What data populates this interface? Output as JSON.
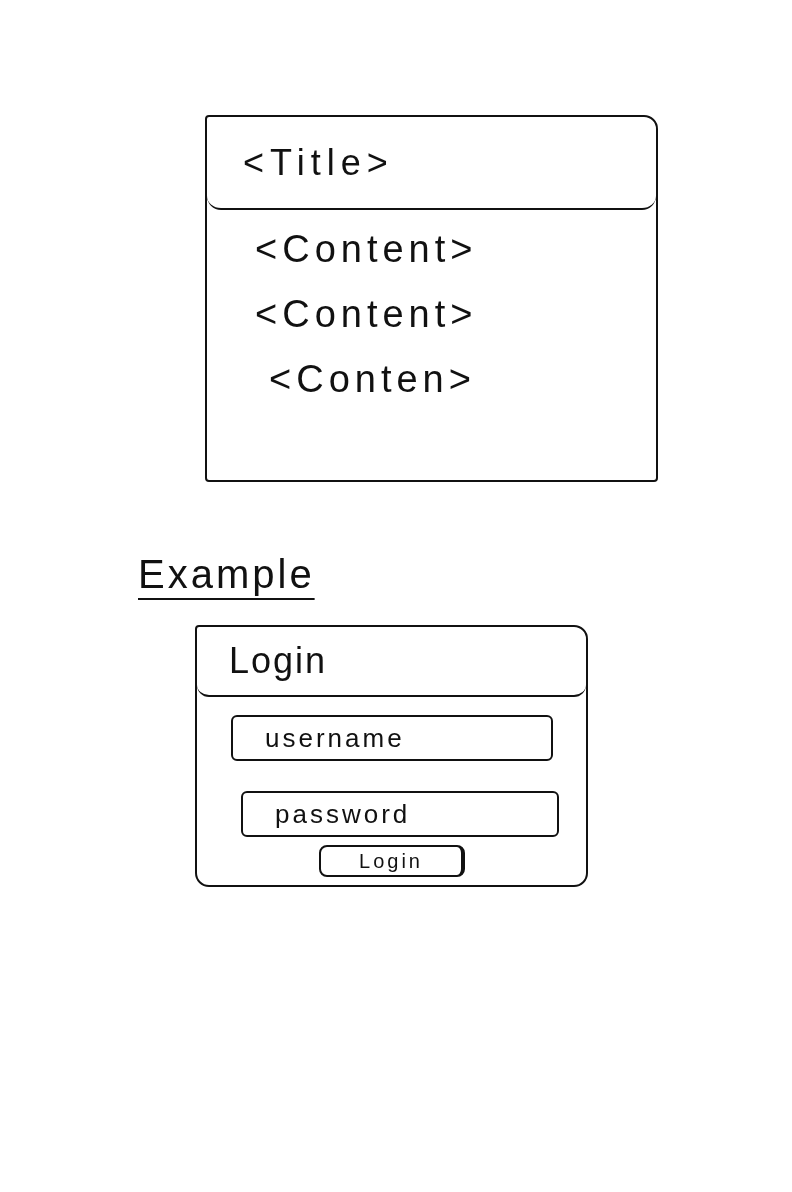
{
  "template": {
    "title": "<Title>",
    "contents": [
      "<Content>",
      "<Content>",
      "<Conten>"
    ]
  },
  "example": {
    "heading": "Example"
  },
  "login": {
    "title": "Login",
    "fields": [
      {
        "placeholder": "username"
      },
      {
        "placeholder": "password"
      }
    ],
    "button": "Login"
  }
}
